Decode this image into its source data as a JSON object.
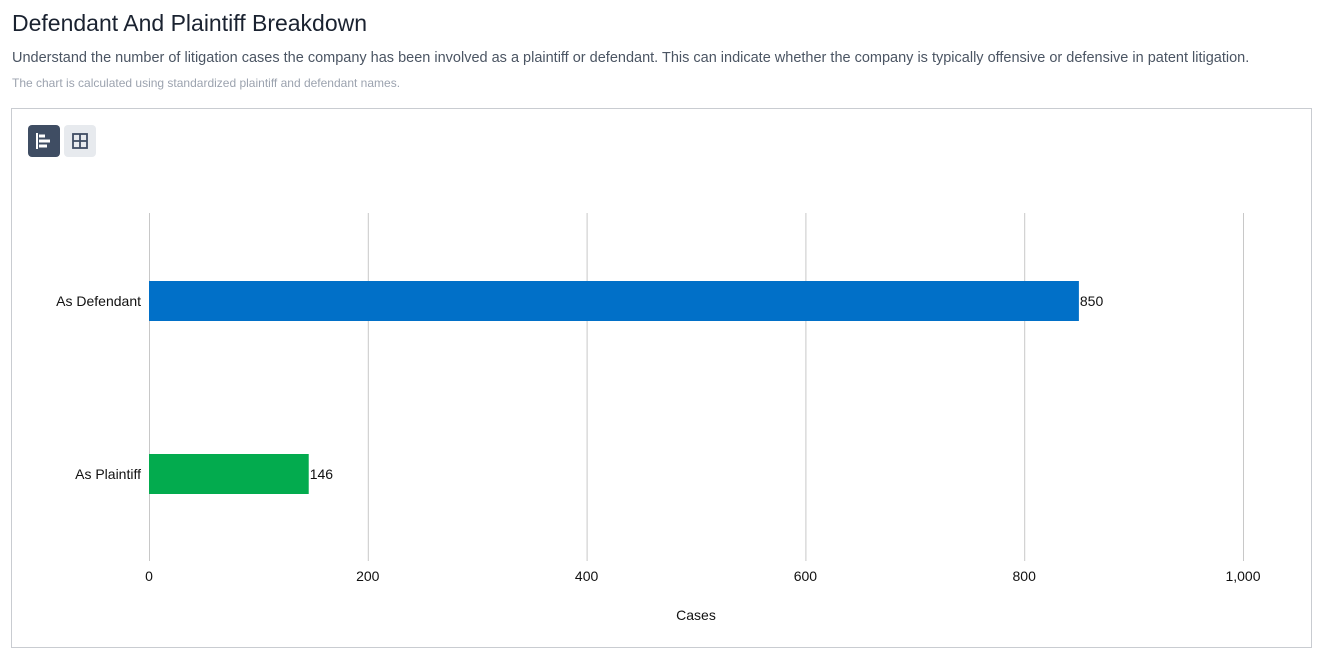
{
  "header": {
    "title": "Defendant And Plaintiff Breakdown",
    "description": "Understand the number of litigation cases the company has been involved as a plaintiff or defendant. This can indicate whether the company is typically offensive or defensive in patent litigation.",
    "note": "The chart is calculated using standardized plaintiff and defendant names."
  },
  "view_toggle": {
    "chart_icon": "horizontal-bar-chart-icon",
    "table_icon": "table-grid-icon",
    "active": "chart"
  },
  "chart_data": {
    "type": "bar",
    "orientation": "horizontal",
    "categories": [
      "As Defendant",
      "As Plaintiff"
    ],
    "values": [
      850,
      146
    ],
    "colors": [
      "#0170c8",
      "#03ab4e"
    ],
    "xlabel": "Cases",
    "ylabel": "",
    "xlim": [
      0,
      1000
    ],
    "ticks": [
      0,
      200,
      400,
      600,
      800,
      1000
    ],
    "tick_labels": [
      "0",
      "200",
      "400",
      "600",
      "800",
      "1,000"
    ],
    "value_labels": [
      "850",
      "146"
    ],
    "grid": true,
    "legend": "none"
  }
}
